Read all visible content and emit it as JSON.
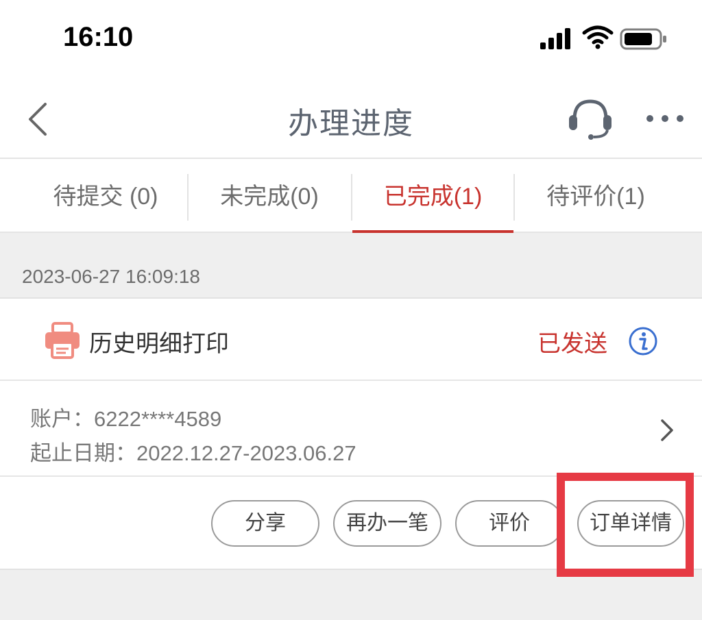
{
  "status_bar": {
    "time": "16:10"
  },
  "header": {
    "title": "办理进度"
  },
  "tabs": [
    {
      "label": "待提交 (0)",
      "active": false
    },
    {
      "label": "未完成(0)",
      "active": false
    },
    {
      "label": "已完成(1)",
      "active": true
    },
    {
      "label": "待评价(1)",
      "active": false
    }
  ],
  "order": {
    "date": "2023-06-27 16:09:18",
    "title": "历史明细打印",
    "status": "已发送",
    "account_line": "账户：6222****4589",
    "period_line": "起止日期：2022.12.27-2023.06.27",
    "actions": {
      "share": "分享",
      "redo": "再办一笔",
      "review": "评价",
      "detail": "订单详情"
    }
  },
  "colors": {
    "accent": "#c8332e",
    "highlight": "#e63a44",
    "info_blue": "#3a6fd0"
  },
  "icons": [
    "back-icon",
    "headset-icon",
    "more-icon",
    "printer-icon",
    "info-icon",
    "chevron-right-icon"
  ]
}
